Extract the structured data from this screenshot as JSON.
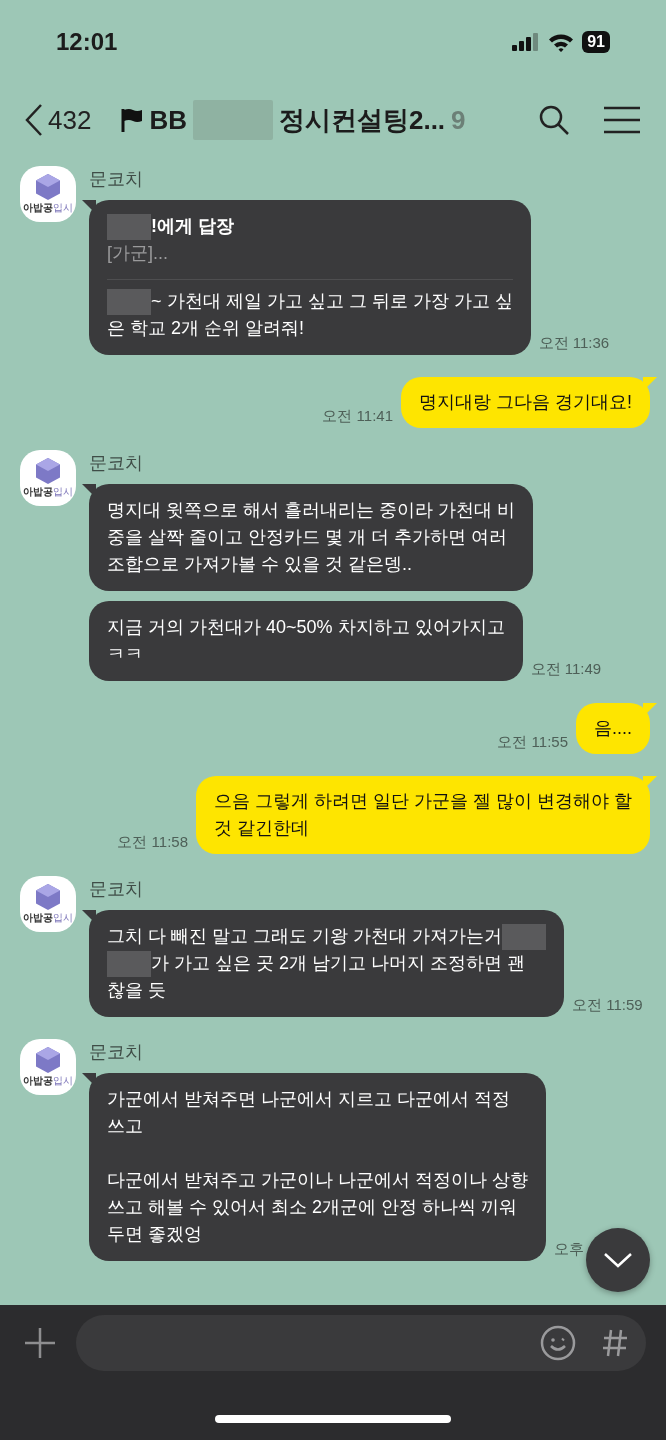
{
  "status_bar": {
    "time": "12:01",
    "battery": "91"
  },
  "header": {
    "back_count": "432",
    "title_start": "BB",
    "title_end": "정시컨설팅2...",
    "member_count": "9"
  },
  "messages": [
    {
      "kind": "incoming",
      "sender": "문코치",
      "avatar": [
        "아밥공",
        "입시"
      ],
      "time": "오전 11:36",
      "bubbles": [
        {
          "reply": {
            "to": "!에게 답장",
            "quote": "[가군]..."
          },
          "paragraphs": [
            [
              {
                "text": "~ 가천대 제일 가고 싶고 그 뒤로 가장 가고 싶",
                "blur_before": true,
                "blur_after": false
              },
              {
                "text": "은 학교 2개 순위 알려줘!",
                "blur_before": false,
                "blur_after": false
              }
            ]
          ]
        }
      ]
    },
    {
      "kind": "outgoing",
      "time": "오전 11:41",
      "bubbles": [
        {
          "paragraphs": [
            [
              {
                "text": "명지대랑 그다음 경기대요!",
                "blur_before": false,
                "blur_after": false
              }
            ]
          ]
        }
      ]
    },
    {
      "kind": "incoming",
      "sender": "문코치",
      "avatar": [
        "아밥공",
        "입시"
      ],
      "time": "오전 11:49",
      "bubbles": [
        {
          "paragraphs": [
            [
              {
                "text": "명지대 윗쪽으로 해서 흘러내리는 중이라 가천대 비",
                "blur_before": false,
                "blur_after": false
              },
              {
                "text": "중을 살짝 줄이고 안정카드 몇 개 더 추가하면 여러",
                "blur_before": false,
                "blur_after": false
              },
              {
                "text": "조합으로 가져가볼 수 있을 것 같은뎅..",
                "blur_before": false,
                "blur_after": false
              }
            ]
          ]
        },
        {
          "paragraphs": [
            [
              {
                "text": "지금 거의 가천대가 40~50% 차지하고 있어가지고",
                "blur_before": false,
                "blur_after": false
              },
              {
                "text": "ㅋㅋ",
                "blur_before": false,
                "blur_after": false
              }
            ]
          ]
        }
      ]
    },
    {
      "kind": "outgoing",
      "time": "오전 11:55",
      "bubbles": [
        {
          "paragraphs": [
            [
              {
                "text": "음....",
                "blur_before": false,
                "blur_after": false
              }
            ]
          ]
        }
      ]
    },
    {
      "kind": "outgoing",
      "time": "오전 11:58",
      "bubbles": [
        {
          "paragraphs": [
            [
              {
                "text": "으음 그렇게 하려면 일단 가군을 젤 많이 변경해야 할",
                "blur_before": false,
                "blur_after": false
              },
              {
                "text": "것 같긴한데",
                "blur_before": false,
                "blur_after": false
              }
            ]
          ]
        }
      ]
    },
    {
      "kind": "incoming",
      "sender": "문코치",
      "avatar": [
        "아밥공",
        "입시"
      ],
      "time": "오전 11:59",
      "bubbles": [
        {
          "paragraphs": [
            [
              {
                "text": "그치 다 빼진 말고 그래도 기왕 가천대 가져가는거",
                "blur_before": false,
                "blur_after": true
              },
              {
                "text": "가 가고 싶은 곳 2개 남기고 나머지 조정하면 괜",
                "blur_before": true,
                "blur_after": false
              },
              {
                "text": "찮을 듯",
                "blur_before": false,
                "blur_after": false
              }
            ]
          ]
        }
      ]
    },
    {
      "kind": "incoming",
      "sender": "문코치",
      "avatar": [
        "아밥공",
        "입시"
      ],
      "time": "오후",
      "bubbles": [
        {
          "paragraphs": [
            [
              {
                "text": "가군에서 받쳐주면 나군에서 지르고 다군에서 적정",
                "blur_before": false,
                "blur_after": false
              },
              {
                "text": "쓰고",
                "blur_before": false,
                "blur_after": false
              }
            ],
            [
              {
                "text": "다군에서 받쳐주고 가군이나 나군에서 적정이나 상향",
                "blur_before": false,
                "blur_after": false
              },
              {
                "text": "쓰고 해볼 수 있어서 최소 2개군에 안정 하나씩 끼워",
                "blur_before": false,
                "blur_after": false
              },
              {
                "text": "두면 좋겠엉",
                "blur_before": false,
                "blur_after": false
              }
            ]
          ]
        }
      ]
    }
  ]
}
